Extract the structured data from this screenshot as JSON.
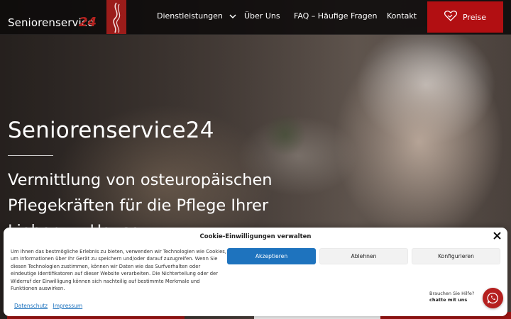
{
  "header": {
    "logo_text": "Seniorenservice",
    "logo_number": "24",
    "nav": {
      "services": "Dienstleistungen",
      "about": "Über Uns",
      "faq": "FAQ – Häufige Fragen",
      "contact": "Kontakt"
    },
    "price_button": "Preise"
  },
  "hero": {
    "title": "Seniorenservice24",
    "subtitle": "Vermittlung von osteuropäischen Pflegekräften für die Pflege Ihrer Lieben zu Hause"
  },
  "cookie": {
    "title": "Cookie-Einwilligungen verwalten",
    "text": "Um Ihnen das bestmögliche Erlebnis zu bieten, verwenden wir Technologien wie Cookies, um Informationen über Ihr Gerät zu speichern und/oder darauf zuzugreifen. Wenn Sie diesen Technologien zustimmen, können wir Daten wie das Surfverhalten oder eindeutige Identifikatoren auf dieser Website verarbeiten. Die Nichterteilung oder der Widerruf der Einwilligung können sich nachteilig auf bestimmte Merkmale und Funktionen auswirken.",
    "accept": "Akzeptieren",
    "deny": "Ablehnen",
    "configure": "Konfigurieren",
    "link_privacy": "Datenschutz",
    "link_imprint": "Impressum"
  },
  "chat": {
    "prompt": "Brauchen Sie Hilfe?",
    "action": "chatte mit uns"
  },
  "colors": {
    "brand_red": "#b20f12",
    "accept_blue": "#1e73be"
  },
  "icons": [
    "chevron-down-icon",
    "handshake-heart-icon",
    "close-icon",
    "whatsapp-icon"
  ]
}
